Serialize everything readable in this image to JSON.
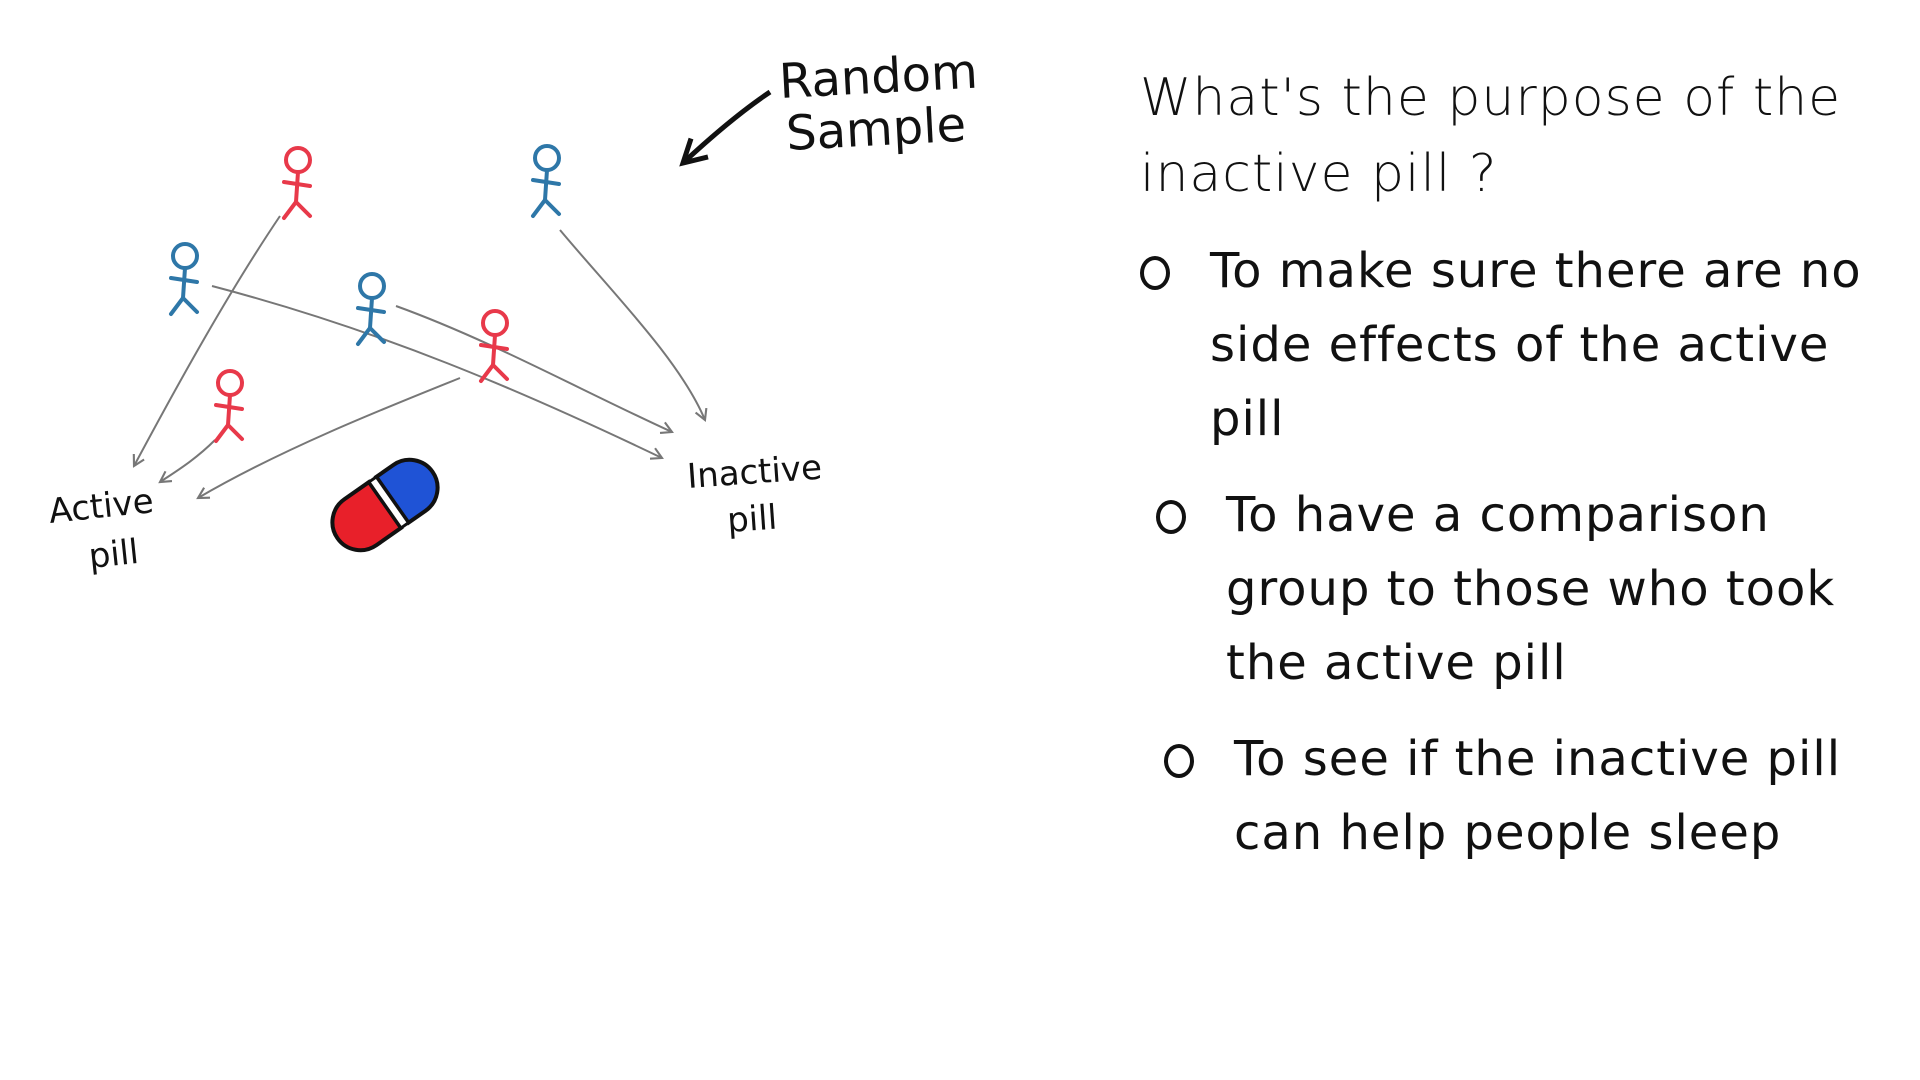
{
  "diagram": {
    "random_sample_label": [
      "Random",
      "Sample"
    ],
    "active_label": [
      "Active",
      "pill"
    ],
    "inactive_label": [
      "Inactive",
      "pill"
    ],
    "people": [
      {
        "color": "red",
        "group": "active"
      },
      {
        "color": "blue",
        "group": "inactive"
      },
      {
        "color": "blue",
        "group": "inactive"
      },
      {
        "color": "blue",
        "group": "inactive"
      },
      {
        "color": "red",
        "group": "active"
      },
      {
        "color": "red",
        "group": "active"
      }
    ],
    "colors": {
      "red": "#e8394a",
      "blue": "#2e77a8",
      "pill_red": "#e8202a",
      "pill_blue": "#1f53d6",
      "arrow": "#777777",
      "ink": "#111111"
    }
  },
  "quiz": {
    "question": "What's the purpose of the inactive pill ?",
    "options": [
      {
        "label": "To make sure there are no side effects of the active pill"
      },
      {
        "label": "To have a comparison group to those who took the active pill"
      },
      {
        "label": "To see if the inactive pill can help people sleep"
      }
    ]
  }
}
